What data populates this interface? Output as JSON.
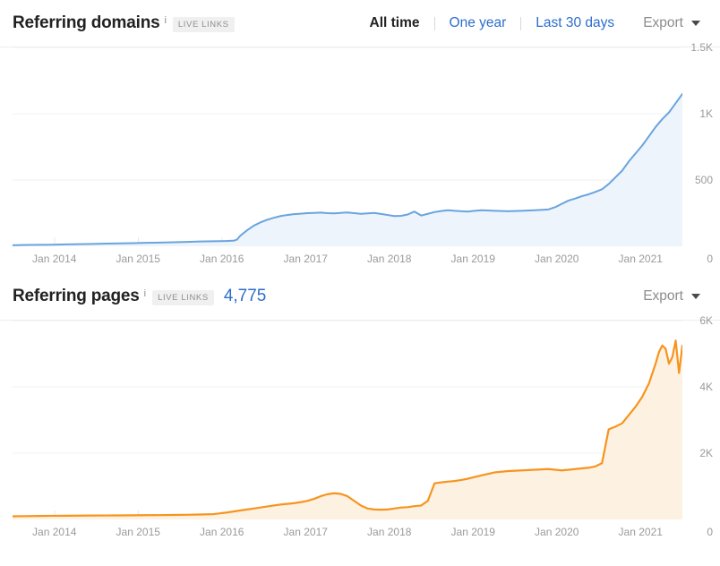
{
  "charts": [
    {
      "id": "referring-domains",
      "title": "Referring domains",
      "info_icon": "i",
      "badge": "Live links",
      "metric_value": "",
      "ranges": [
        {
          "label": "All time",
          "active": true
        },
        {
          "label": "One year",
          "active": false
        },
        {
          "label": "Last 30 days",
          "active": false
        }
      ],
      "export_label": "Export",
      "line_color": "#6aa4dd",
      "fill_color": "#eef4fc",
      "chart_data": {
        "type": "area",
        "title": "Referring domains",
        "xlabel": "",
        "ylabel": "",
        "grid": true,
        "legend_position": "none",
        "ylim": [
          0,
          1500
        ],
        "yticks": [
          1500,
          1000,
          500,
          0
        ],
        "ytick_labels": [
          "1.5K",
          "1K",
          "500",
          "0"
        ],
        "xticks": [
          "Jan 2014",
          "Jan 2015",
          "Jan 2016",
          "Jan 2017",
          "Jan 2018",
          "Jan 2019",
          "Jan 2020",
          "Jan 2021"
        ],
        "xlim": [
          "mid 2013",
          "mid 2021"
        ],
        "series": [
          {
            "name": "Referring domains",
            "color": "#6aa4dd",
            "x": [
              0,
              0.02,
              0.04,
              0.06,
              0.08,
              0.1,
              0.12,
              0.14,
              0.16,
              0.18,
              0.2,
              0.22,
              0.24,
              0.26,
              0.28,
              0.3,
              0.32,
              0.33,
              0.335,
              0.34,
              0.35,
              0.36,
              0.37,
              0.38,
              0.39,
              0.4,
              0.41,
              0.42,
              0.43,
              0.44,
              0.45,
              0.46,
              0.47,
              0.48,
              0.49,
              0.5,
              0.51,
              0.52,
              0.53,
              0.54,
              0.55,
              0.56,
              0.57,
              0.58,
              0.59,
              0.6,
              0.61,
              0.62,
              0.63,
              0.64,
              0.65,
              0.66,
              0.67,
              0.68,
              0.69,
              0.7,
              0.72,
              0.74,
              0.76,
              0.78,
              0.8,
              0.81,
              0.82,
              0.83,
              0.84,
              0.85,
              0.86,
              0.87,
              0.88,
              0.89,
              0.9,
              0.91,
              0.92,
              0.93,
              0.94,
              0.95,
              0.96,
              0.97,
              0.98,
              0.99,
              1.0
            ],
            "values": [
              8,
              10,
              11,
              12,
              14,
              16,
              18,
              20,
              22,
              24,
              26,
              28,
              30,
              33,
              36,
              38,
              40,
              42,
              50,
              80,
              120,
              155,
              180,
              200,
              215,
              228,
              236,
              242,
              246,
              250,
              252,
              254,
              250,
              248,
              252,
              255,
              250,
              245,
              248,
              252,
              244,
              236,
              228,
              230,
              240,
              262,
              232,
              245,
              258,
              266,
              272,
              268,
              264,
              262,
              268,
              272,
              268,
              264,
              268,
              272,
              278,
              295,
              320,
              345,
              360,
              378,
              392,
              410,
              430,
              470,
              520,
              570,
              640,
              700,
              760,
              830,
              900,
              960,
              1010,
              1080,
              1150
            ]
          }
        ]
      }
    },
    {
      "id": "referring-pages",
      "title": "Referring pages",
      "info_icon": "i",
      "badge": "Live links",
      "metric_value": "4,775",
      "ranges": [],
      "export_label": "Export",
      "line_color": "#f7941e",
      "fill_color": "#fdf1e2",
      "chart_data": {
        "type": "area",
        "title": "Referring pages",
        "xlabel": "",
        "ylabel": "",
        "grid": true,
        "legend_position": "none",
        "ylim": [
          0,
          6000
        ],
        "yticks": [
          6000,
          4000,
          2000,
          0
        ],
        "ytick_labels": [
          "6K",
          "4K",
          "2K",
          "0"
        ],
        "xticks": [
          "Jan 2014",
          "Jan 2015",
          "Jan 2016",
          "Jan 2017",
          "Jan 2018",
          "Jan 2019",
          "Jan 2020",
          "Jan 2021"
        ],
        "xlim": [
          "mid 2013",
          "mid 2021"
        ],
        "series": [
          {
            "name": "Referring pages",
            "color": "#f7941e",
            "x": [
              0,
              0.02,
              0.04,
              0.06,
              0.08,
              0.1,
              0.12,
              0.14,
              0.16,
              0.18,
              0.2,
              0.22,
              0.24,
              0.26,
              0.28,
              0.3,
              0.31,
              0.32,
              0.33,
              0.34,
              0.35,
              0.36,
              0.37,
              0.38,
              0.39,
              0.4,
              0.41,
              0.42,
              0.43,
              0.44,
              0.45,
              0.46,
              0.47,
              0.48,
              0.49,
              0.5,
              0.51,
              0.52,
              0.53,
              0.54,
              0.55,
              0.56,
              0.57,
              0.58,
              0.59,
              0.6,
              0.61,
              0.62,
              0.63,
              0.64,
              0.65,
              0.66,
              0.67,
              0.68,
              0.7,
              0.72,
              0.74,
              0.76,
              0.78,
              0.8,
              0.81,
              0.82,
              0.83,
              0.84,
              0.85,
              0.86,
              0.87,
              0.88,
              0.89,
              0.9,
              0.91,
              0.92,
              0.93,
              0.94,
              0.95,
              0.955,
              0.96,
              0.965,
              0.97,
              0.975,
              0.98,
              0.985,
              0.99,
              0.995,
              1.0
            ],
            "values": [
              95,
              100,
              105,
              110,
              112,
              115,
              118,
              120,
              122,
              125,
              128,
              130,
              135,
              140,
              148,
              160,
              185,
              210,
              240,
              270,
              300,
              330,
              360,
              390,
              420,
              450,
              470,
              490,
              520,
              560,
              620,
              700,
              760,
              790,
              770,
              700,
              560,
              420,
              330,
              300,
              295,
              300,
              330,
              360,
              370,
              400,
              420,
              560,
              1090,
              1120,
              1140,
              1160,
              1190,
              1230,
              1330,
              1420,
              1460,
              1480,
              1500,
              1520,
              1500,
              1480,
              1500,
              1520,
              1540,
              1560,
              1600,
              1700,
              2720,
              2800,
              2900,
              3150,
              3400,
              3700,
              4100,
              4400,
              4700,
              5050,
              5250,
              5150,
              4700,
              4900,
              5400,
              4420,
              5250
            ]
          }
        ]
      }
    }
  ]
}
